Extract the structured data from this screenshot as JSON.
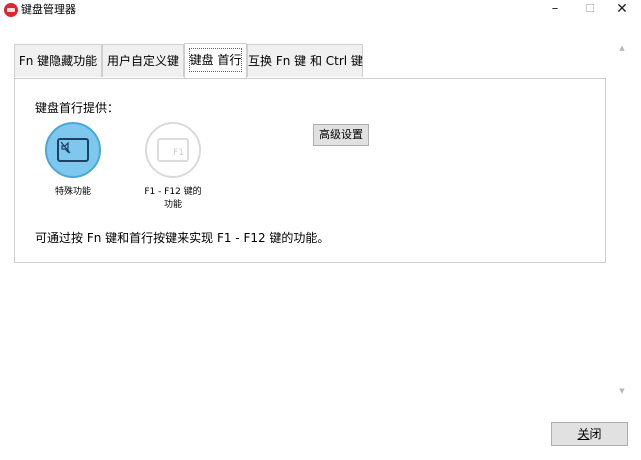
{
  "window": {
    "title": "键盘管理器",
    "minimize_glyph": "–",
    "maximize_glyph": "☐",
    "close_glyph": "✕"
  },
  "tabs": [
    {
      "label": "Fn 键隐藏功能"
    },
    {
      "label": "用户自定义键"
    },
    {
      "label": "键盘 首行",
      "active": true
    },
    {
      "label": "互换 Fn 键 和 Ctrl 键"
    }
  ],
  "panel": {
    "heading": "键盘首行提供：",
    "options": [
      {
        "label": "特殊功能",
        "selected": true,
        "icon": "keyboard-mute-icon"
      },
      {
        "label": "F1 - F12 键的\n功能",
        "selected": false,
        "icon": "keyboard-f1-icon",
        "key_label": "F1"
      }
    ],
    "advanced_button": "高级设置",
    "description": "可通过按 Fn 键和首行按键来实现 F1 - F12 键的功能。"
  },
  "footer": {
    "close_button_underlined": "关",
    "close_button_rest": "闭"
  },
  "colors": {
    "selected_fill": "#7ec8ee",
    "selected_border": "#4aa6db",
    "icon_dark": "#1e3f66",
    "app_icon": "#d9282f"
  }
}
